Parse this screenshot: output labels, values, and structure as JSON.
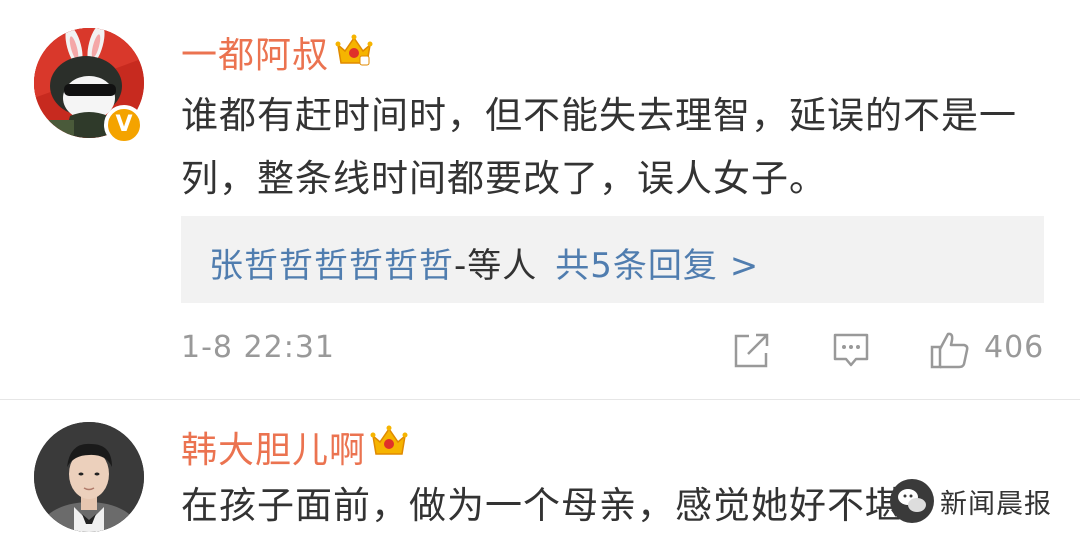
{
  "comments": [
    {
      "username": "一都阿叔",
      "verified_badge": "V",
      "avatar_icon": "cartoon-soldier-avatar",
      "text": "谁都有赶时间时，但不能失去理智，延误的不是一列，整条线时间都要改了，误人女子。",
      "replies": {
        "names": "张哲哲哲哲哲哲",
        "separator": "-等人",
        "count_label": "共5条回复 >"
      },
      "timestamp": "1-8 22:31",
      "likes": "406"
    },
    {
      "username": "韩大胆儿啊",
      "avatar_icon": "man-portrait-avatar",
      "text": "在孩子面前，做为一个母亲，感觉她好不堪"
    }
  ],
  "watermark": {
    "label": "新闻晨报",
    "icon": "wechat-logo-icon"
  },
  "colors": {
    "username": "#eb7350",
    "link": "#507daf",
    "body_text": "#333333",
    "meta_text": "#999999",
    "reply_bg": "#f2f2f2"
  }
}
